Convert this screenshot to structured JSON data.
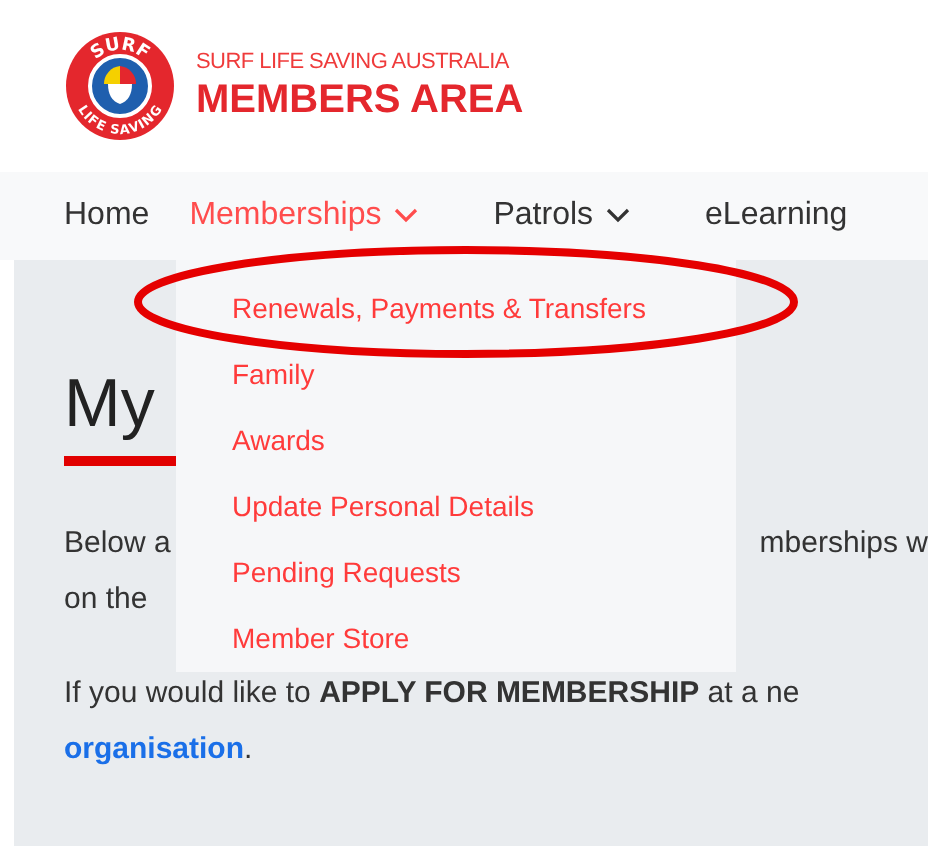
{
  "logo": {
    "ring_top": "SURF",
    "ring_bottom": "LIFE SAVING",
    "subtitle": "SURF LIFE SAVING AUSTRALIA",
    "title": "MEMBERS AREA"
  },
  "nav": [
    {
      "label": "Home",
      "selected": false,
      "dropdown": false
    },
    {
      "label": "Memberships",
      "selected": true,
      "dropdown": true
    },
    {
      "label": "Patrols",
      "selected": false,
      "dropdown": true
    },
    {
      "label": "eLearning",
      "selected": false,
      "dropdown": false
    }
  ],
  "dropdown_menu": [
    "Renewals, Payments & Transfers",
    "Family",
    "Awards",
    "Update Personal Details",
    "Pending Requests",
    "Member Store"
  ],
  "content": {
    "heading": "My",
    "line_1_left": "Below a",
    "line_1_right": "mberships w",
    "line_2_left": "on the",
    "paragraph": "If you would like to **APPLY FOR MEMBERSHIP** at a ne",
    "link": "organisation",
    "link_after": "."
  }
}
